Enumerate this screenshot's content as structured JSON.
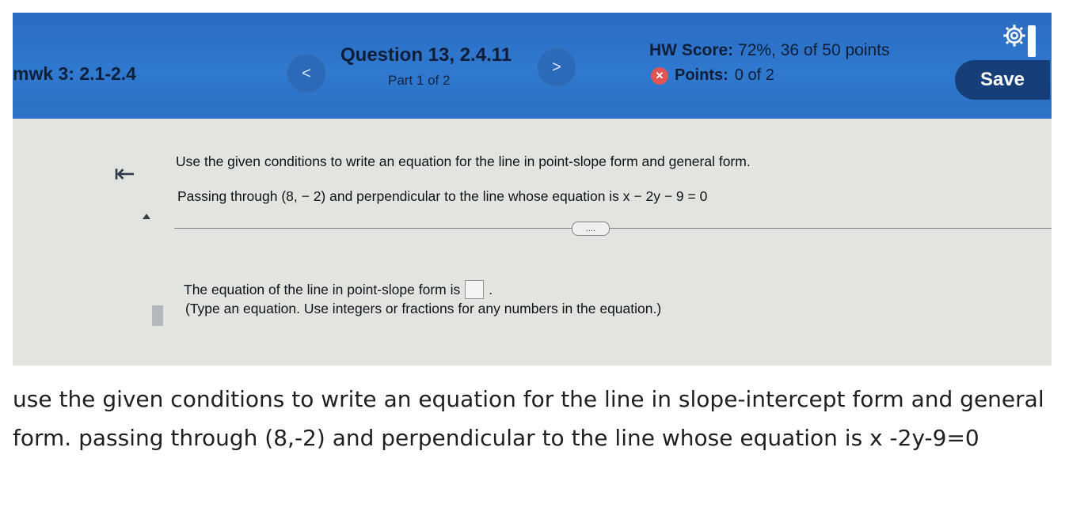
{
  "screenshot": {
    "assignment_title": "mwk 3: 2.1-2.4",
    "prev_icon": "chevron-left-icon",
    "next_icon": "chevron-right-icon",
    "prev_glyph": "<",
    "next_glyph": ">",
    "question_title": "Question 13, 2.4.11",
    "question_part": "Part 1 of 2",
    "hw_score_label": "HW Score:",
    "hw_score_value": "72%, 36 of 50 points",
    "points_label": "Points:",
    "points_value": "0 of 2",
    "save_label": "Save",
    "collapse_glyph": "⇤",
    "instructions": "Use the given conditions to write an equation for the line in point-slope form and general form.",
    "conditions": "Passing through (8, − 2) and perpendicular to the line whose equation is x − 2y − 9 = 0",
    "more_label": "....",
    "answer_prompt": "The equation of the line in point-slope form is",
    "answer_suffix": ".",
    "hint": "(Type an equation. Use integers or fractions for any numbers in the equation.)",
    "colors": {
      "header_blue": "#2f79cf",
      "save_bg": "#163f7a",
      "error_red": "#e05454"
    }
  },
  "question_text": "use the given conditions to write an equation for the line in slope-intercept form and general form. passing through (8,-2) and perpendicular to the line whose equation is x -2y-9=0"
}
